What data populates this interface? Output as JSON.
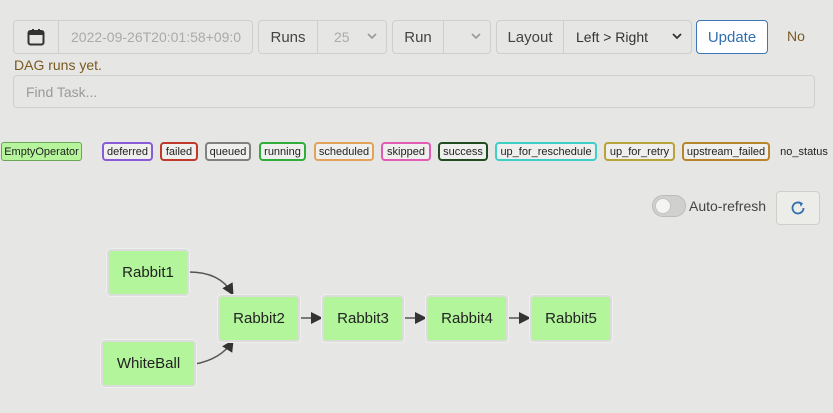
{
  "toolbar": {
    "date_value": "2022-09-26T20:01:58+09:0",
    "runs_label": "Runs",
    "runs_value": "25",
    "run_label": "Run",
    "run_value": "",
    "layout_label": "Layout",
    "layout_value": "Left > Right",
    "update_label": "Update",
    "no_runs_text_line1": "No",
    "no_runs_text_line2": "DAG runs yet."
  },
  "search": {
    "placeholder": "Find Task..."
  },
  "legend": {
    "operator": "EmptyOperator",
    "states": [
      {
        "label": "deferred",
        "color": "#8a5bd6"
      },
      {
        "label": "failed",
        "color": "#c0392b"
      },
      {
        "label": "queued",
        "color": "#808080"
      },
      {
        "label": "running",
        "color": "#2fae3a"
      },
      {
        "label": "scheduled",
        "color": "#e3a25a"
      },
      {
        "label": "skipped",
        "color": "#e25bb4"
      },
      {
        "label": "success",
        "color": "#1f4d1f"
      },
      {
        "label": "up_for_reschedule",
        "color": "#3ecfc6"
      },
      {
        "label": "up_for_retry",
        "color": "#b8a23a"
      },
      {
        "label": "upstream_failed",
        "color": "#b8862a"
      },
      {
        "label": "no_status",
        "color": ""
      }
    ]
  },
  "graph": {
    "auto_refresh_label": "Auto-refresh",
    "nodes": {
      "rabbit1": "Rabbit1",
      "whiteball": "WhiteBall",
      "rabbit2": "Rabbit2",
      "rabbit3": "Rabbit3",
      "rabbit4": "Rabbit4",
      "rabbit5": "Rabbit5"
    }
  },
  "colors": {
    "node_fill": "#b2f59a",
    "accent": "#2f6fb0"
  }
}
